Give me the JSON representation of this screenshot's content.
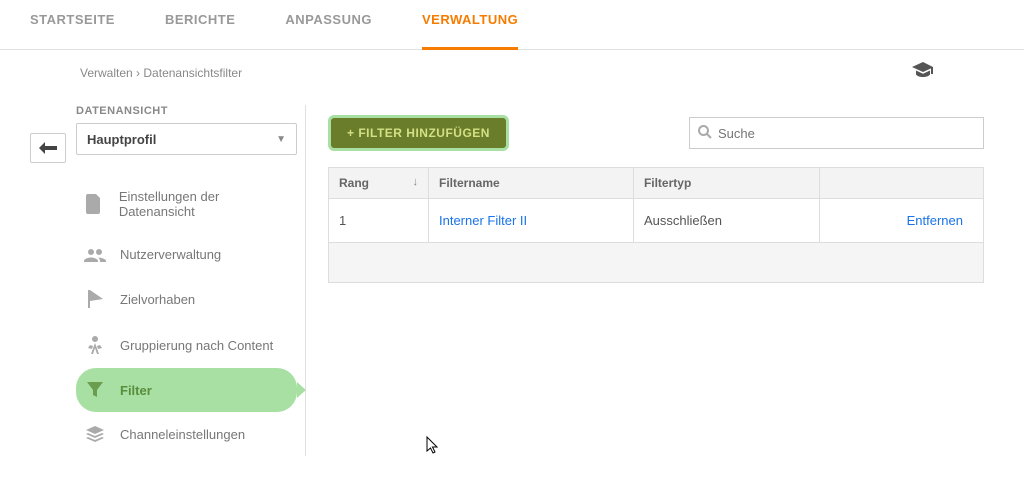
{
  "topnav": {
    "items": [
      {
        "label": "STARTSEITE"
      },
      {
        "label": "BERICHTE"
      },
      {
        "label": "ANPASSUNG"
      },
      {
        "label": "VERWALTUNG"
      }
    ],
    "activeIndex": 3
  },
  "breadcrumb": {
    "a": "Verwalten",
    "sep": "›",
    "b": "Datenansichtsfilter"
  },
  "sidebar": {
    "section_label": "DATENANSICHT",
    "selected_view": "Hauptprofil",
    "items": [
      {
        "label": "Einstellungen der Datenansicht"
      },
      {
        "label": "Nutzerverwaltung"
      },
      {
        "label": "Zielvorhaben"
      },
      {
        "label": "Gruppierung nach Content"
      },
      {
        "label": "Filter"
      },
      {
        "label": "Channeleinstellungen"
      }
    ],
    "activeIndex": 4
  },
  "content": {
    "add_button": "+ FILTER HINZUFÜGEN",
    "search_placeholder": "Suche",
    "table": {
      "headers": {
        "rank": "Rang",
        "name": "Filtername",
        "type": "Filtertyp"
      },
      "rows": [
        {
          "rank": "1",
          "name": "Interner Filter II",
          "type": "Ausschließen",
          "remove": "Entfernen"
        }
      ]
    }
  }
}
